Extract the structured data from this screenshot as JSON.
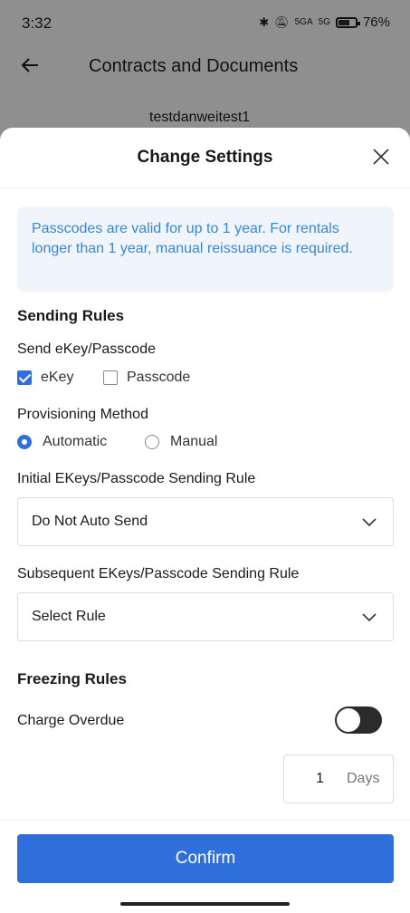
{
  "status_bar": {
    "time": "3:32",
    "network": "5GA",
    "network2": "5G",
    "battery": "76%"
  },
  "header": {
    "title": "Contracts and Documents"
  },
  "background": {
    "tenant_name": "testdanweitest1"
  },
  "sheet": {
    "title": "Change Settings",
    "info": "Passcodes are valid for up to 1 year. For rentals longer than 1 year, manual reissuance is required.",
    "sending_rules": {
      "title": "Sending Rules",
      "send_label": "Send eKey/Passcode",
      "options": [
        {
          "label": "eKey",
          "checked": true
        },
        {
          "label": "Passcode",
          "checked": false
        }
      ],
      "provisioning_label": "Provisioning Method",
      "provisioning_options": [
        {
          "label": "Automatic",
          "selected": true
        },
        {
          "label": "Manual",
          "selected": false
        }
      ],
      "initial_label": "Initial EKeys/Passcode Sending Rule",
      "initial_value": "Do Not Auto Send",
      "subsequent_label": "Subsequent EKeys/Passcode Sending Rule",
      "subsequent_value": "Select Rule"
    },
    "freezing_rules": {
      "title": "Freezing Rules",
      "charge_overdue_label": "Charge Overdue",
      "charge_overdue_enabled": false,
      "days_value": "1",
      "days_unit": "Days"
    },
    "confirm_label": "Confirm"
  },
  "colors": {
    "accent": "#2e6fdc",
    "info_text": "#3a86d6",
    "info_bg": "#f0f5fb",
    "toggle_off": "#2b2b2b"
  }
}
